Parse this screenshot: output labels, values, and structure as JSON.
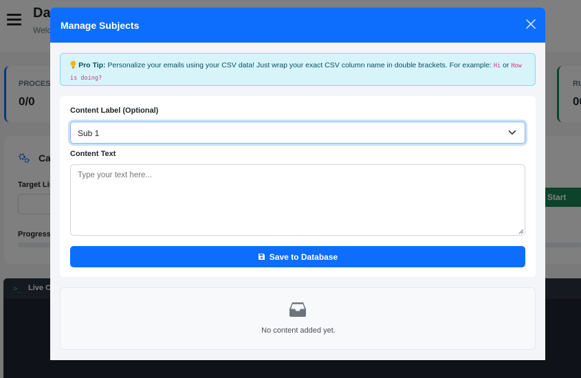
{
  "background": {
    "title": "Da",
    "subtitle": "Welc",
    "stat_left": {
      "label": "PROCESS",
      "value": "0/0"
    },
    "stat_right": {
      "label": "RU",
      "value": "00"
    },
    "campaign": {
      "title": "Ca",
      "target_label": "Target Lis",
      "progress_label": "Progress",
      "start_label": "Start"
    },
    "console": {
      "title": "Live Co"
    }
  },
  "modal": {
    "title": "Manage Subjects",
    "tip": {
      "icon": "lightbulb-icon",
      "strong": "Pro Tip:",
      "text": "Personalize your emails using your CSV data! Just wrap your exact CSV column name in double brackets. For example:",
      "example1": "Hi",
      "connector": "or",
      "example2": "How is doing?"
    },
    "form": {
      "content_label_label": "Content Label (Optional)",
      "selected_label": "Sub 1",
      "content_text_label": "Content Text",
      "content_text_placeholder": "Type your text here...",
      "save_button": "Save to Database"
    },
    "empty_state": {
      "icon": "inbox-icon",
      "text": "No content added yet."
    }
  },
  "colors": {
    "primary": "#0d6efd",
    "tip_bg": "#d7f4fb",
    "tip_border": "#7fdcee",
    "success": "#198754"
  }
}
